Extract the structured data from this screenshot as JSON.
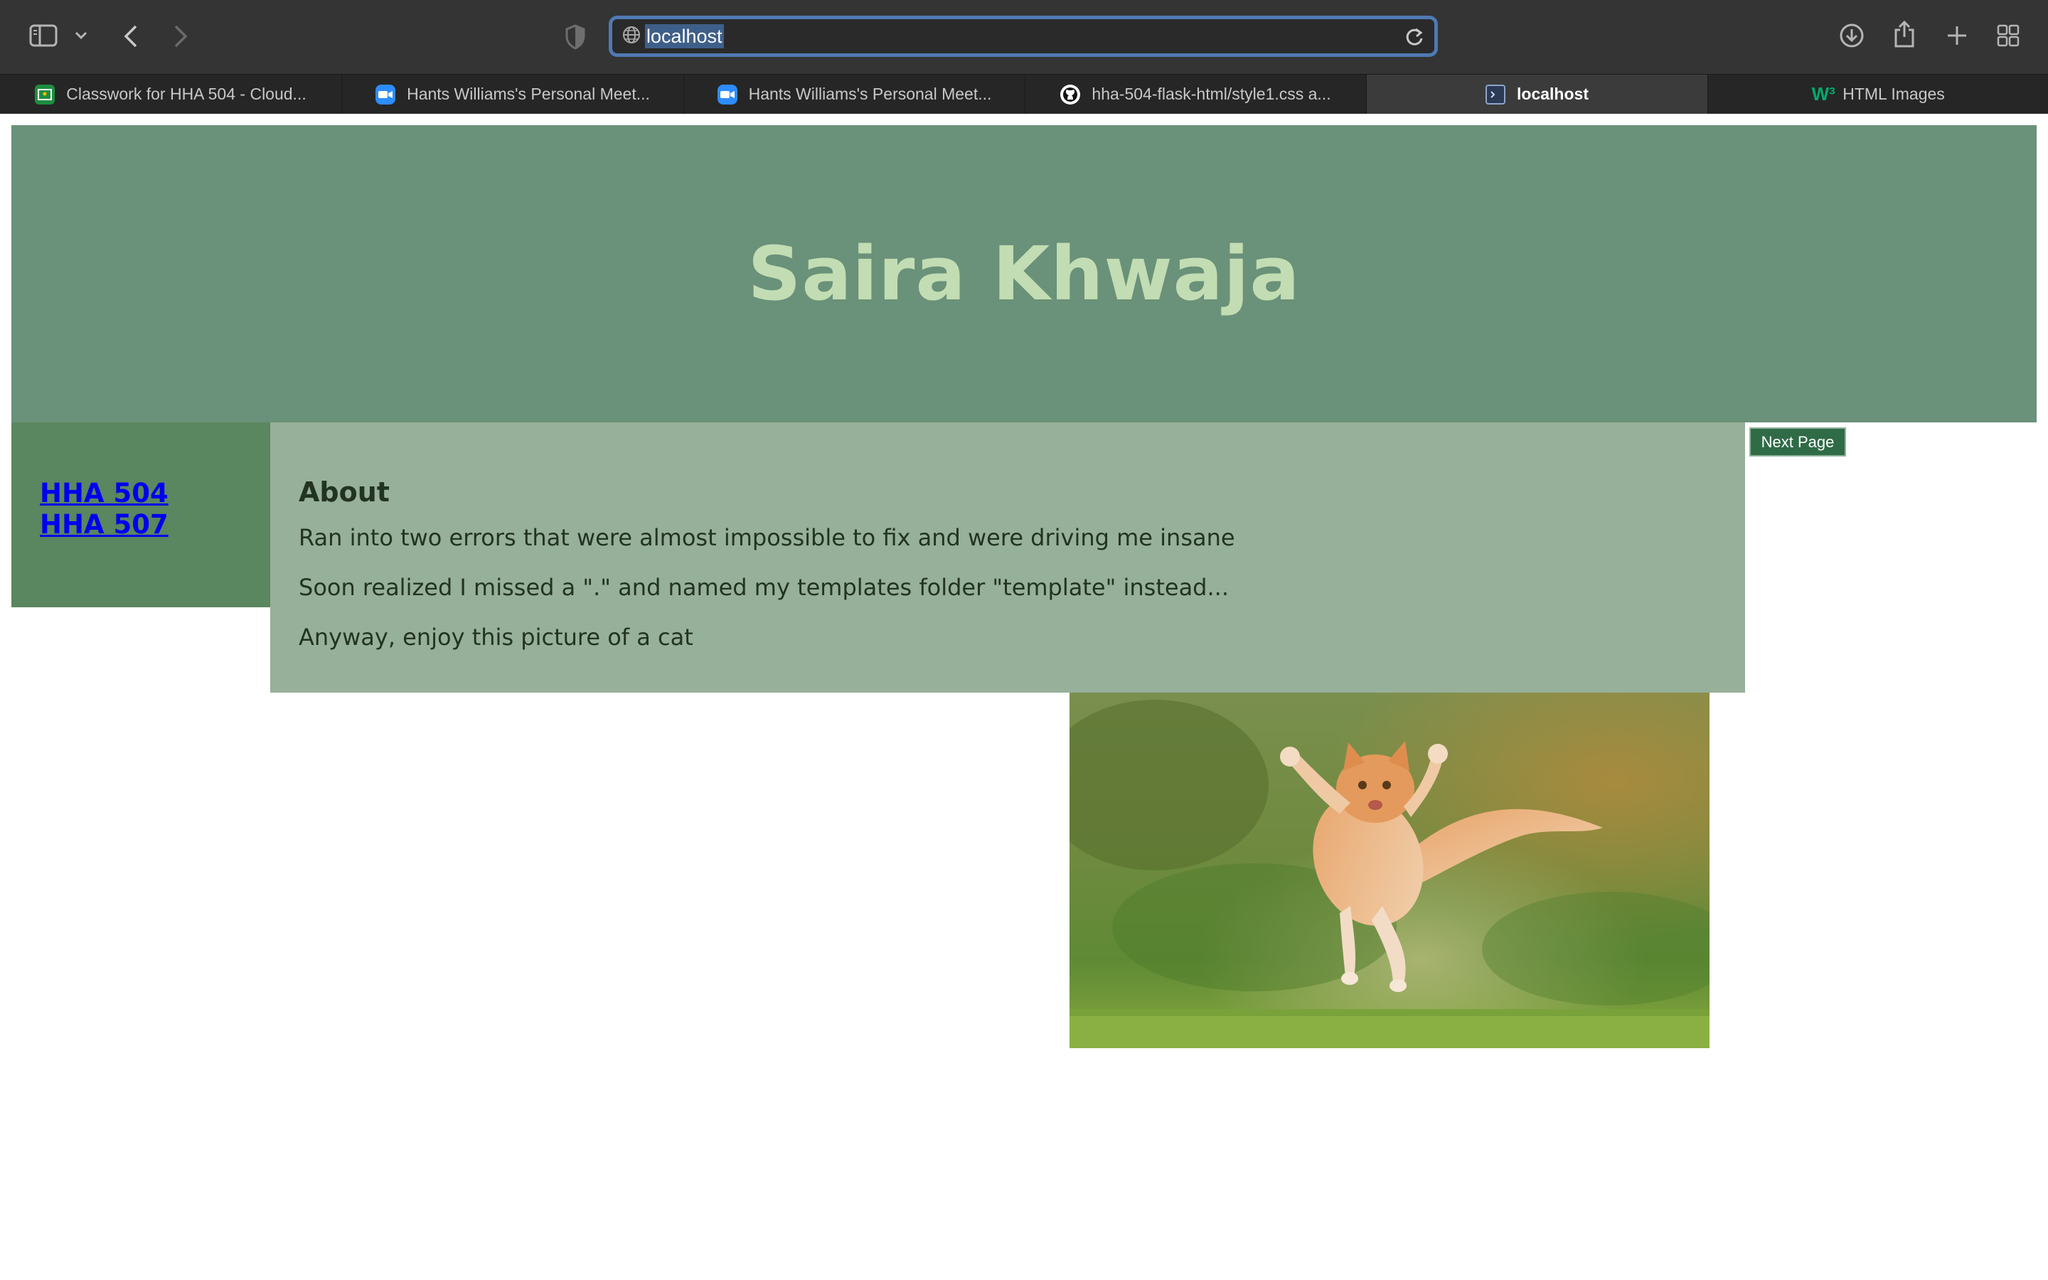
{
  "browser": {
    "url": "localhost",
    "tabs": [
      {
        "label": "Classwork for HHA 504 - Cloud...",
        "icon": "google-classroom-icon"
      },
      {
        "label": "Hants Williams's Personal Meet...",
        "icon": "zoom-icon"
      },
      {
        "label": "Hants Williams's Personal Meet...",
        "icon": "zoom-icon"
      },
      {
        "label": "hha-504-flask-html/style1.css a...",
        "icon": "github-icon"
      },
      {
        "label": "localhost",
        "icon": "terminal-icon",
        "active": true
      },
      {
        "label": "HTML Images",
        "icon": "w3schools-icon"
      }
    ],
    "w3_glyph": "W³"
  },
  "page": {
    "title": "Saira Khwaja",
    "nav": [
      "HHA 504",
      "HHA 507"
    ],
    "about": {
      "heading": "About",
      "paragraphs": [
        "Ran into two errors that were almost impossible to fix and were driving me insane",
        "Soon realized I missed a \".\" and named my templates folder \"template\" instead...",
        "Anyway, enjoy this picture of a cat"
      ]
    },
    "next_button": "Next Page",
    "image": {
      "subject": "jumping orange-and-white kitten on grass"
    }
  },
  "colors": {
    "header_bg": "#6a9179",
    "title_text": "#c2ddb3",
    "sidebar_bg": "#5a8660",
    "main_bg": "#97b099",
    "button_bg": "#2f6b46",
    "link": "#0000ee"
  }
}
